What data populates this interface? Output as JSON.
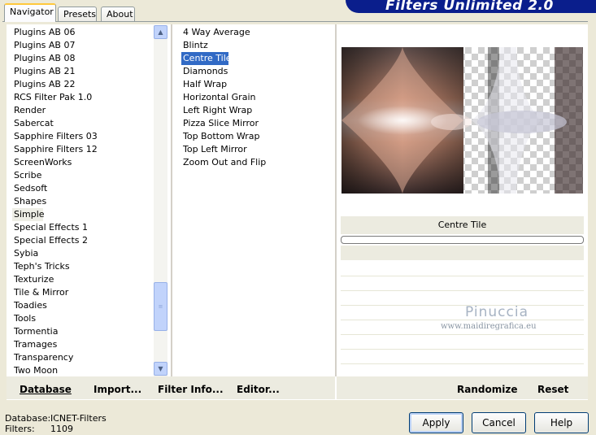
{
  "tabs": [
    {
      "label": "Navigator",
      "active": true
    },
    {
      "label": "Presets",
      "active": false
    },
    {
      "label": "About",
      "active": false
    }
  ],
  "banner": {
    "title": "Filters Unlimited 2.0"
  },
  "categories": [
    "Plugins AB 06",
    "Plugins AB 07",
    "Plugins AB 08",
    "Plugins AB 21",
    "Plugins AB 22",
    "RCS Filter Pak 1.0",
    "Render",
    "Sabercat",
    "Sapphire Filters 03",
    "Sapphire Filters 12",
    "ScreenWorks",
    "Scribe",
    "Sedsoft",
    "Shapes",
    "Simple",
    "Special Effects 1",
    "Special Effects 2",
    "Sybia",
    "Teph's Tricks",
    "Texturize",
    "Tile & Mirror",
    "Toadies",
    "Tools",
    "Tormentia",
    "Tramages",
    "Transparency",
    "Two Moon"
  ],
  "highlighted_category": "Simple",
  "filters": [
    "4 Way Average",
    "Blintz",
    "Centre Tile",
    "Diamonds",
    "Half Wrap",
    "Horizontal Grain",
    "Left Right Wrap",
    "Pizza Slice Mirror",
    "Top Bottom Wrap",
    "Top Left Mirror",
    "Zoom Out and Flip"
  ],
  "selected_filter": "Centre Tile",
  "preview": {
    "filter_name": "Centre Tile"
  },
  "watermark": {
    "name": "Pinuccia",
    "url": "www.maidiregrafica.eu"
  },
  "left_buttons": {
    "database": "Database",
    "import": "Import...",
    "filter_info": "Filter Info...",
    "editor": "Editor..."
  },
  "right_buttons": {
    "randomize": "Randomize",
    "reset": "Reset"
  },
  "status": {
    "database_label": "Database:",
    "database_value": "ICNET-Filters",
    "filters_label": "Filters:",
    "filters_value": "1109"
  },
  "dialog_buttons": {
    "apply": "Apply",
    "cancel": "Cancel",
    "help": "Help"
  },
  "colors": {
    "selection": "#316ac5",
    "banner": "#0a1e8c",
    "panel_bg": "#ecebe0"
  }
}
